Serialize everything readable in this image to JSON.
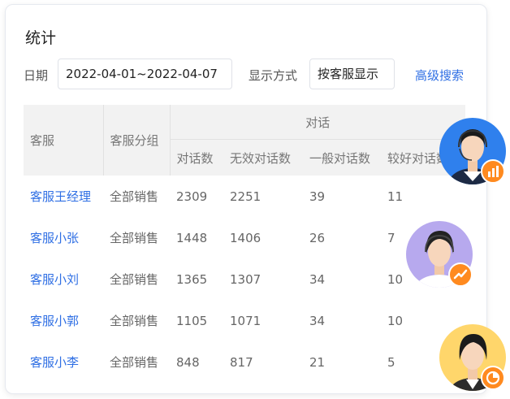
{
  "panel": {
    "title": "统计"
  },
  "filters": {
    "date_label": "日期",
    "date_value": "2022-04-01~2022-04-07",
    "display_label": "显示方式",
    "display_value": "按客服显示",
    "advanced_search": "高级搜索"
  },
  "table": {
    "head": {
      "agent": "客服",
      "group": "客服分组",
      "conversation": "对话"
    },
    "sub_columns": [
      "对话数",
      "无效对话数",
      "一般对话数",
      "较好对话数"
    ],
    "rows": [
      {
        "name": "客服王经理",
        "group": "全部销售",
        "values": [
          "2309",
          "2251",
          "39",
          "11"
        ]
      },
      {
        "name": "客服小张",
        "group": "全部销售",
        "values": [
          "1448",
          "1406",
          "26",
          "7"
        ]
      },
      {
        "name": "客服小刘",
        "group": "全部销售",
        "values": [
          "1365",
          "1307",
          "34",
          "10"
        ]
      },
      {
        "name": "客服小郭",
        "group": "全部销售",
        "values": [
          "1105",
          "1071",
          "34",
          "10"
        ]
      },
      {
        "name": "客服小李",
        "group": "全部销售",
        "values": [
          "848",
          "817",
          "21",
          "5"
        ]
      }
    ]
  },
  "floating_avatars": [
    {
      "icon": "bar-chart-icon",
      "bg": "#2f80ed",
      "badge": "#ff8a1f"
    },
    {
      "icon": "trend-line-icon",
      "bg": "#b7a9ee",
      "badge": "#ff8a1f"
    },
    {
      "icon": "pie-chart-icon",
      "bg": "#ffd66b",
      "badge": "#ff8a1f"
    }
  ]
}
